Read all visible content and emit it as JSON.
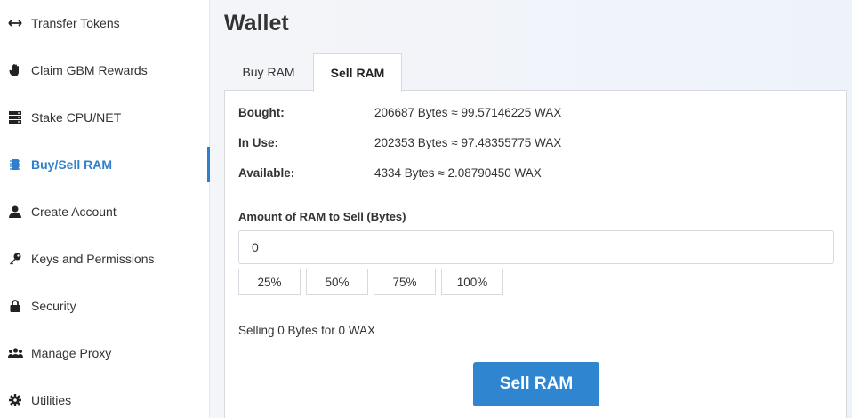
{
  "sidebar": {
    "items": [
      {
        "label": "Transfer Tokens",
        "icon": "arrows-horizontal-icon"
      },
      {
        "label": "Claim GBM Rewards",
        "icon": "hand-icon"
      },
      {
        "label": "Stake CPU/NET",
        "icon": "server-icon"
      },
      {
        "label": "Buy/Sell RAM",
        "icon": "chip-icon",
        "active": true
      },
      {
        "label": "Create Account",
        "icon": "user-icon"
      },
      {
        "label": "Keys and Permissions",
        "icon": "key-icon"
      },
      {
        "label": "Security",
        "icon": "lock-icon"
      },
      {
        "label": "Manage Proxy",
        "icon": "users-icon"
      },
      {
        "label": "Utilities",
        "icon": "gear-icon"
      }
    ]
  },
  "page": {
    "title": "Wallet"
  },
  "tabs": [
    {
      "label": "Buy RAM",
      "active": false
    },
    {
      "label": "Sell RAM",
      "active": true
    }
  ],
  "ram": {
    "bought_label": "Bought:",
    "bought_value": "206687 Bytes ≈ 99.57146225 WAX",
    "in_use_label": "In Use:",
    "in_use_value": "202353 Bytes ≈ 97.48355775 WAX",
    "available_label": "Available:",
    "available_value": "4334 Bytes ≈ 2.08790450 WAX"
  },
  "form": {
    "amount_label": "Amount of RAM to Sell (Bytes)",
    "amount_value": "0",
    "percent_buttons": [
      "25%",
      "50%",
      "75%",
      "100%"
    ],
    "summary": "Selling 0 Bytes for 0 WAX",
    "submit_label": "Sell RAM"
  },
  "colors": {
    "accent": "#2f85d0",
    "active_nav": "#2f7fcc"
  }
}
